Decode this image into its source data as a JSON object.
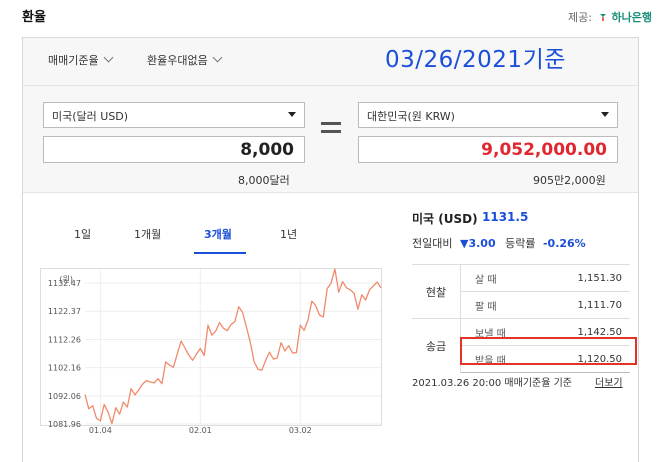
{
  "header": {
    "title": "환율",
    "provider_label": "제공:",
    "provider_name": "하나은행"
  },
  "toolbar": {
    "rate_type": "매매기준율",
    "preferential": "환율우대없음",
    "basis_note": "03/26/2021기준"
  },
  "converter": {
    "from_currency": "미국(달러 USD)",
    "to_currency": "대한민국(원 KRW)",
    "from_amount": "8,000",
    "to_amount": "9,052,000.00",
    "from_text": "8,000달러",
    "to_text": "905만2,000원"
  },
  "periods": [
    "1일",
    "1개월",
    "3개월",
    "1년"
  ],
  "active_period": "3개월",
  "summary": {
    "country": "미국 (USD)",
    "rate": "1131.5",
    "change_label": "전일대비",
    "change_arrow": "▼",
    "change_value": "3.00",
    "pct_label": "등락률",
    "pct_value": "-0.26%"
  },
  "rates_table": [
    {
      "group": "현찰",
      "label": "살 때",
      "value": "1,151.30"
    },
    {
      "group": "",
      "label": "팔 때",
      "value": "1,111.70"
    },
    {
      "group": "송금",
      "label": "보낼 때",
      "value": "1,142.50"
    },
    {
      "group": "",
      "label": "받을 때",
      "value": "1,120.50"
    }
  ],
  "footnote": "2021.03.26 20:00 매매기준율 기준",
  "more_link": "더보기",
  "chart_data": {
    "type": "line",
    "unit_label": "(원)",
    "y_ticks": [
      "1132.47",
      "1122.37",
      "1112.26",
      "1102.16",
      "1092.06",
      "1081.96"
    ],
    "y_range": [
      1081.96,
      1137.5
    ],
    "x_ticks": [
      "01.04",
      "02.01",
      "03.02"
    ],
    "color": "#f08a6c",
    "series": [
      {
        "values": [
          1092.5,
          1087.4,
          1088.5,
          1084.0,
          1083.1,
          1089.0,
          1086.2,
          1082.1,
          1087.8,
          1085.5,
          1089.8,
          1088.0,
          1094.6,
          1092.4,
          1094.2,
          1096.3,
          1097.5,
          1097.0,
          1096.7,
          1098.2,
          1096.4,
          1104.2,
          1103.0,
          1102.3,
          1107.1,
          1111.7,
          1109.2,
          1106.7,
          1104.8,
          1107.0,
          1109.0,
          1106.5,
          1117.4,
          1113.8,
          1115.2,
          1118.3,
          1116.3,
          1115.4,
          1117.6,
          1118.7,
          1124.0,
          1121.9,
          1116.6,
          1111.2,
          1104.3,
          1101.6,
          1101.2,
          1104.8,
          1107.7,
          1105.2,
          1105.6,
          1111.1,
          1108.1,
          1110.0,
          1107.4,
          1107.5,
          1117.4,
          1115.5,
          1119.2,
          1126.0,
          1124.4,
          1121.0,
          1120.3,
          1130.5,
          1132.4,
          1137.5,
          1129.2,
          1133.0,
          1130.8,
          1130.0,
          1128.8,
          1123.1,
          1128.3,
          1126.4,
          1130.0,
          1131.4,
          1132.8,
          1130.8
        ]
      }
    ]
  }
}
